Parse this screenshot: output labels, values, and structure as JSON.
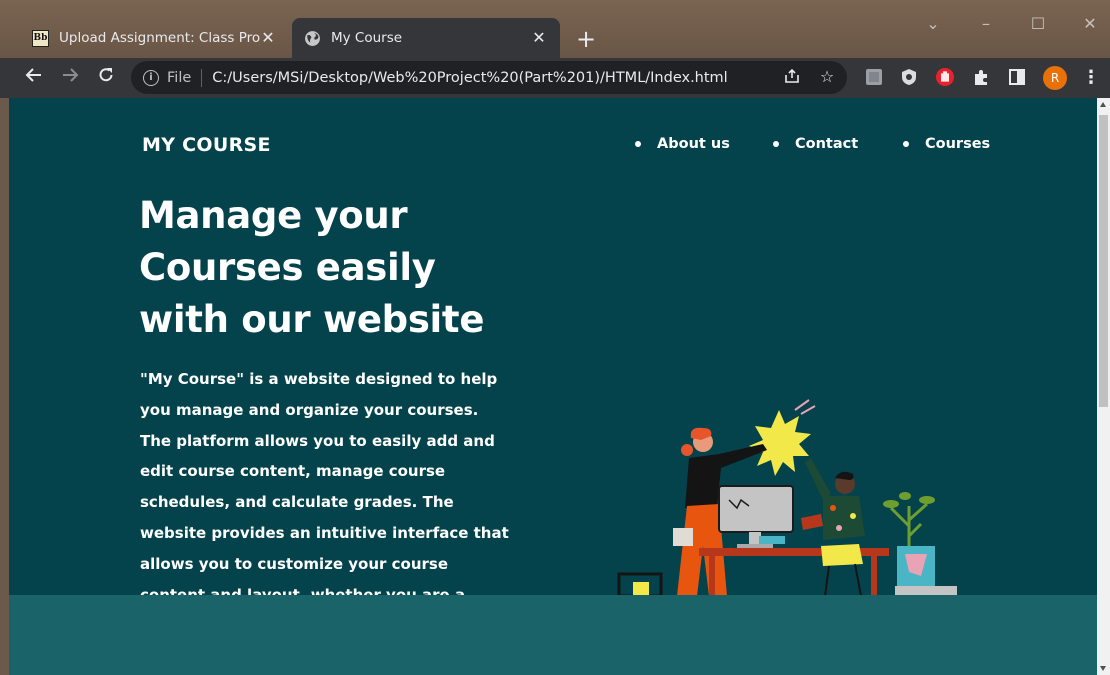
{
  "browser": {
    "tabs": [
      {
        "title": "Upload Assignment: Class Project",
        "favicon_text": "Bb"
      },
      {
        "title": "My Course"
      }
    ],
    "omnibox": {
      "scheme_label": "File",
      "url": "C:/Users/MSi/Desktop/Web%20Project%20(Part%201)/HTML/Index.html"
    },
    "profile_initial": "R"
  },
  "page": {
    "logo": "MY COURSE",
    "nav": [
      "About us",
      "Contact",
      "Courses"
    ],
    "headline": [
      "Manage your",
      "Courses easily",
      "with our website"
    ],
    "description": "\"My Course\" is a website designed to help you manage and organize your courses. The platform allows you to easily add and edit course content, manage course schedules, and calculate grades. The website provides an intuitive interface that allows you to customize your course content and layout, whether you are a teacher, professor, or",
    "colors": {
      "background": "#04434c",
      "footer_band": "#1a6469",
      "text": "#ffffff"
    }
  }
}
